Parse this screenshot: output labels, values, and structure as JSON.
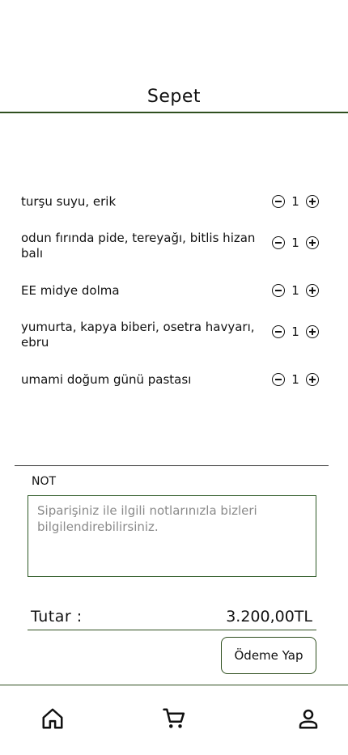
{
  "header": {
    "title": "Sepet"
  },
  "cart": {
    "items": [
      {
        "name": "turşu suyu, erik",
        "qty": "1"
      },
      {
        "name": "odun fırında pide, tereyağı, bitlis hizan balı",
        "qty": "1"
      },
      {
        "name": "EE midye dolma",
        "qty": "1"
      },
      {
        "name": "yumurta, kapya biberi, osetra havyarı, ebru",
        "qty": "1"
      },
      {
        "name": "umami doğum günü pastası",
        "qty": "1"
      }
    ]
  },
  "note": {
    "label": "NOT",
    "placeholder": "Siparişiniz ile ilgili notlarınızla bizleri bilgilendirebilirsiniz.",
    "value": ""
  },
  "total": {
    "label": "Tutar :",
    "value": "3.200,00TL"
  },
  "pay_button": {
    "label": "Ödeme Yap"
  },
  "tabbar": {
    "icons": [
      "home-icon",
      "cart-icon",
      "profile-icon"
    ]
  },
  "colors": {
    "accent": "#2f4f1f"
  }
}
